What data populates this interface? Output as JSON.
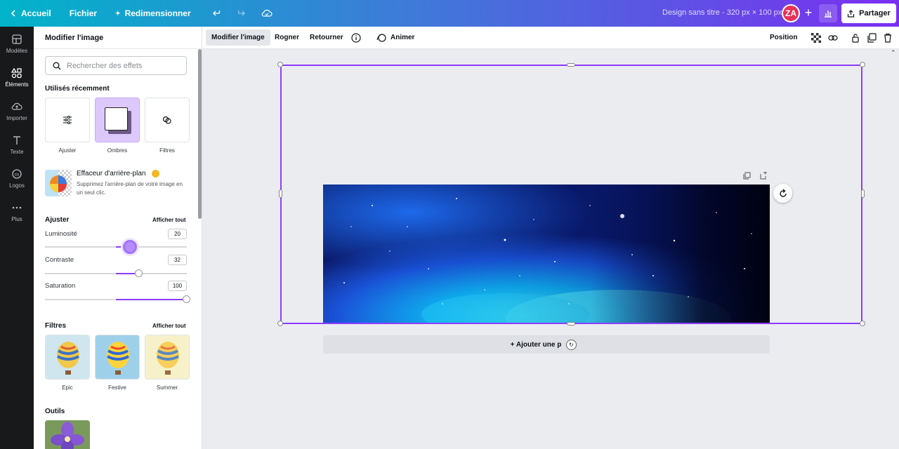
{
  "topbar": {
    "home_label": "Accueil",
    "file_label": "Fichier",
    "resize_label": "Redimensionner",
    "design_title": "Design sans titre - 320 px × 100 px",
    "avatar_initials": "ZA",
    "share_label": "Partager"
  },
  "rail": {
    "items": [
      {
        "label": "Modèles",
        "icon": "layout-icon"
      },
      {
        "label": "Éléments",
        "icon": "shapes-icon"
      },
      {
        "label": "Importer",
        "icon": "cloud-upload-icon"
      },
      {
        "label": "Texte",
        "icon": "text-icon"
      },
      {
        "label": "Logos",
        "icon": "logo-icon"
      },
      {
        "label": "Plus",
        "icon": "more-icon"
      }
    ]
  },
  "panel": {
    "title": "Modifier l'image",
    "search_placeholder": "Rechercher des effets",
    "recent_title": "Utilisés récemment",
    "recent": [
      {
        "label": "Ajuster"
      },
      {
        "label": "Ombres"
      },
      {
        "label": "Filtres"
      }
    ],
    "bg_remover": {
      "title": "Effaceur d'arrière-plan",
      "desc": "Supprimez l'arrière-plan de votre image en un seul clic."
    },
    "adjust": {
      "title": "Ajuster",
      "show_all": "Afficher tout",
      "sliders": [
        {
          "label": "Luminosité",
          "value": "20"
        },
        {
          "label": "Contraste",
          "value": "32"
        },
        {
          "label": "Saturation",
          "value": "100"
        }
      ]
    },
    "filters": {
      "title": "Filtres",
      "show_all": "Afficher tout",
      "items": [
        {
          "label": "Epic"
        },
        {
          "label": "Festive"
        },
        {
          "label": "Summer"
        }
      ]
    },
    "tools_title": "Outils"
  },
  "context_toolbar": {
    "edit_image": "Modifier l'image",
    "crop": "Rogner",
    "flip": "Retourner",
    "animate": "Animer",
    "position": "Position"
  },
  "canvas": {
    "add_page": "+ Ajouter une p"
  },
  "colors": {
    "accent": "#8b3dff",
    "topbar_start": "#01b4c9",
    "topbar_end": "#7a2ff0"
  }
}
